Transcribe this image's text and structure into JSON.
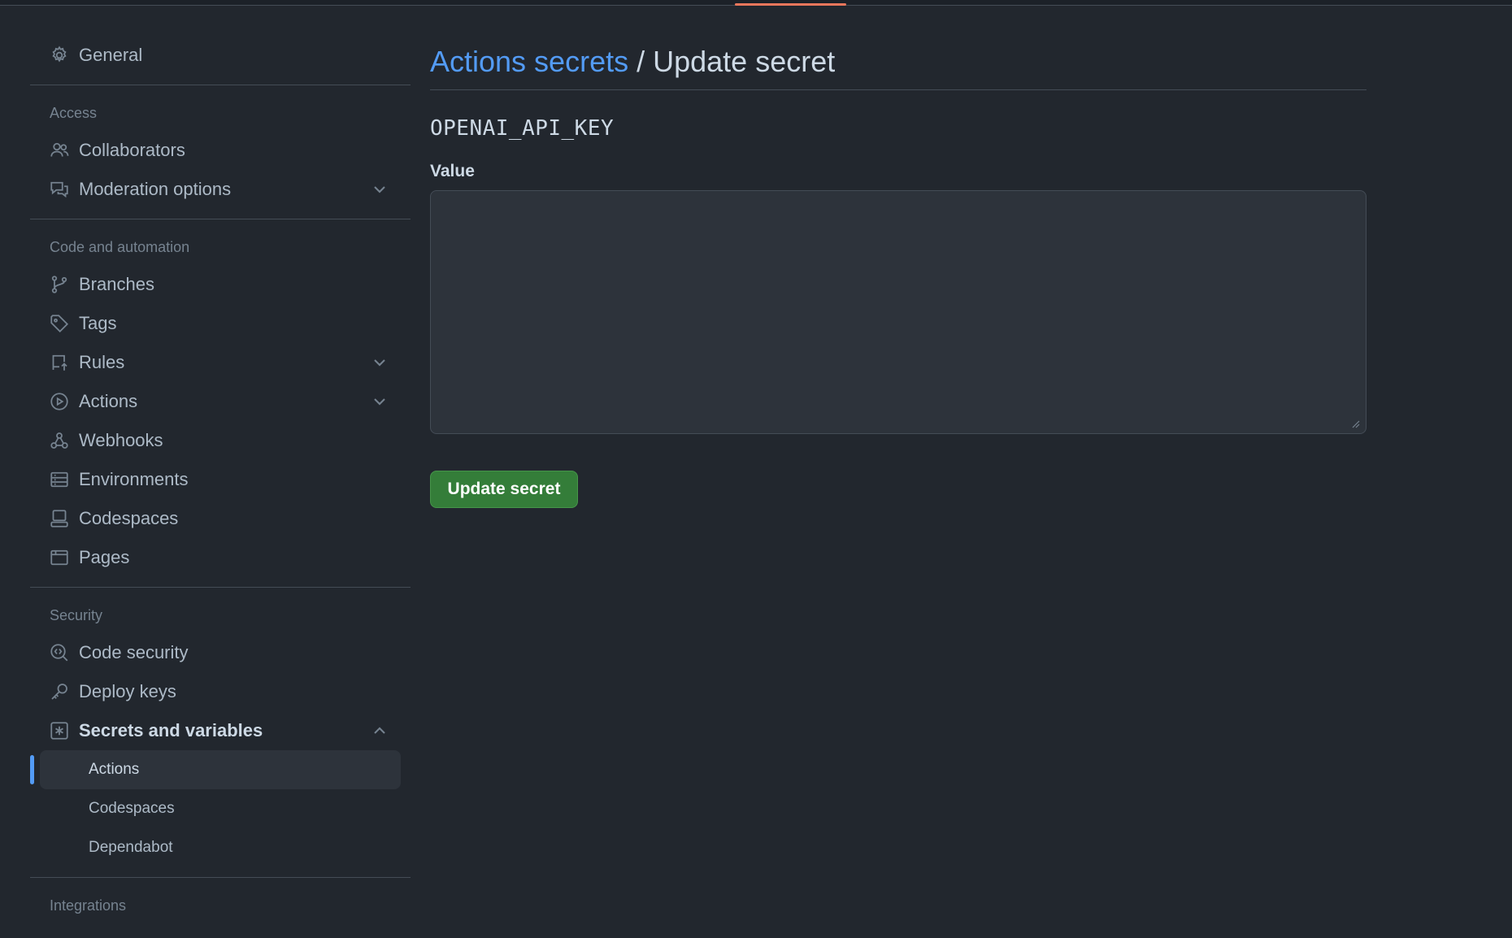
{
  "sidebar": {
    "general": "General",
    "access_label": "Access",
    "collaborators": "Collaborators",
    "moderation": "Moderation options",
    "code_label": "Code and automation",
    "branches": "Branches",
    "tags": "Tags",
    "rules": "Rules",
    "actions": "Actions",
    "webhooks": "Webhooks",
    "environments": "Environments",
    "codespaces": "Codespaces",
    "pages": "Pages",
    "security_label": "Security",
    "code_security": "Code security",
    "deploy_keys": "Deploy keys",
    "secrets": "Secrets and variables",
    "sub_actions": "Actions",
    "sub_codespaces": "Codespaces",
    "sub_dependabot": "Dependabot",
    "integrations_label": "Integrations"
  },
  "main": {
    "breadcrumb_link": "Actions secrets",
    "breadcrumb_sep": "/",
    "breadcrumb_current": "Update secret",
    "secret_name": "OPENAI_API_KEY",
    "value_label": "Value",
    "value": "",
    "button_label": "Update secret"
  },
  "colors": {
    "background": "#22272e",
    "link": "#539bf5",
    "button": "#347d39",
    "accent_tab": "#ec775c"
  }
}
